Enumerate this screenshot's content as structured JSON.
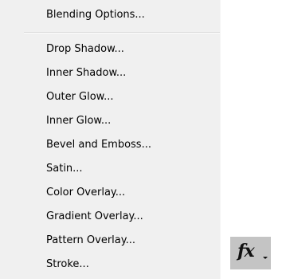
{
  "menu": {
    "header_item": "Blending Options...",
    "items": [
      "Drop Shadow...",
      "Inner Shadow...",
      "Outer Glow...",
      "Inner Glow...",
      "Bevel and Emboss...",
      "Satin...",
      "Color Overlay...",
      "Gradient Overlay...",
      "Pattern Overlay...",
      "Stroke..."
    ]
  },
  "fx_button": {
    "label": "fx",
    "icon": "fx-icon",
    "has_dropdown_arrow": true
  }
}
